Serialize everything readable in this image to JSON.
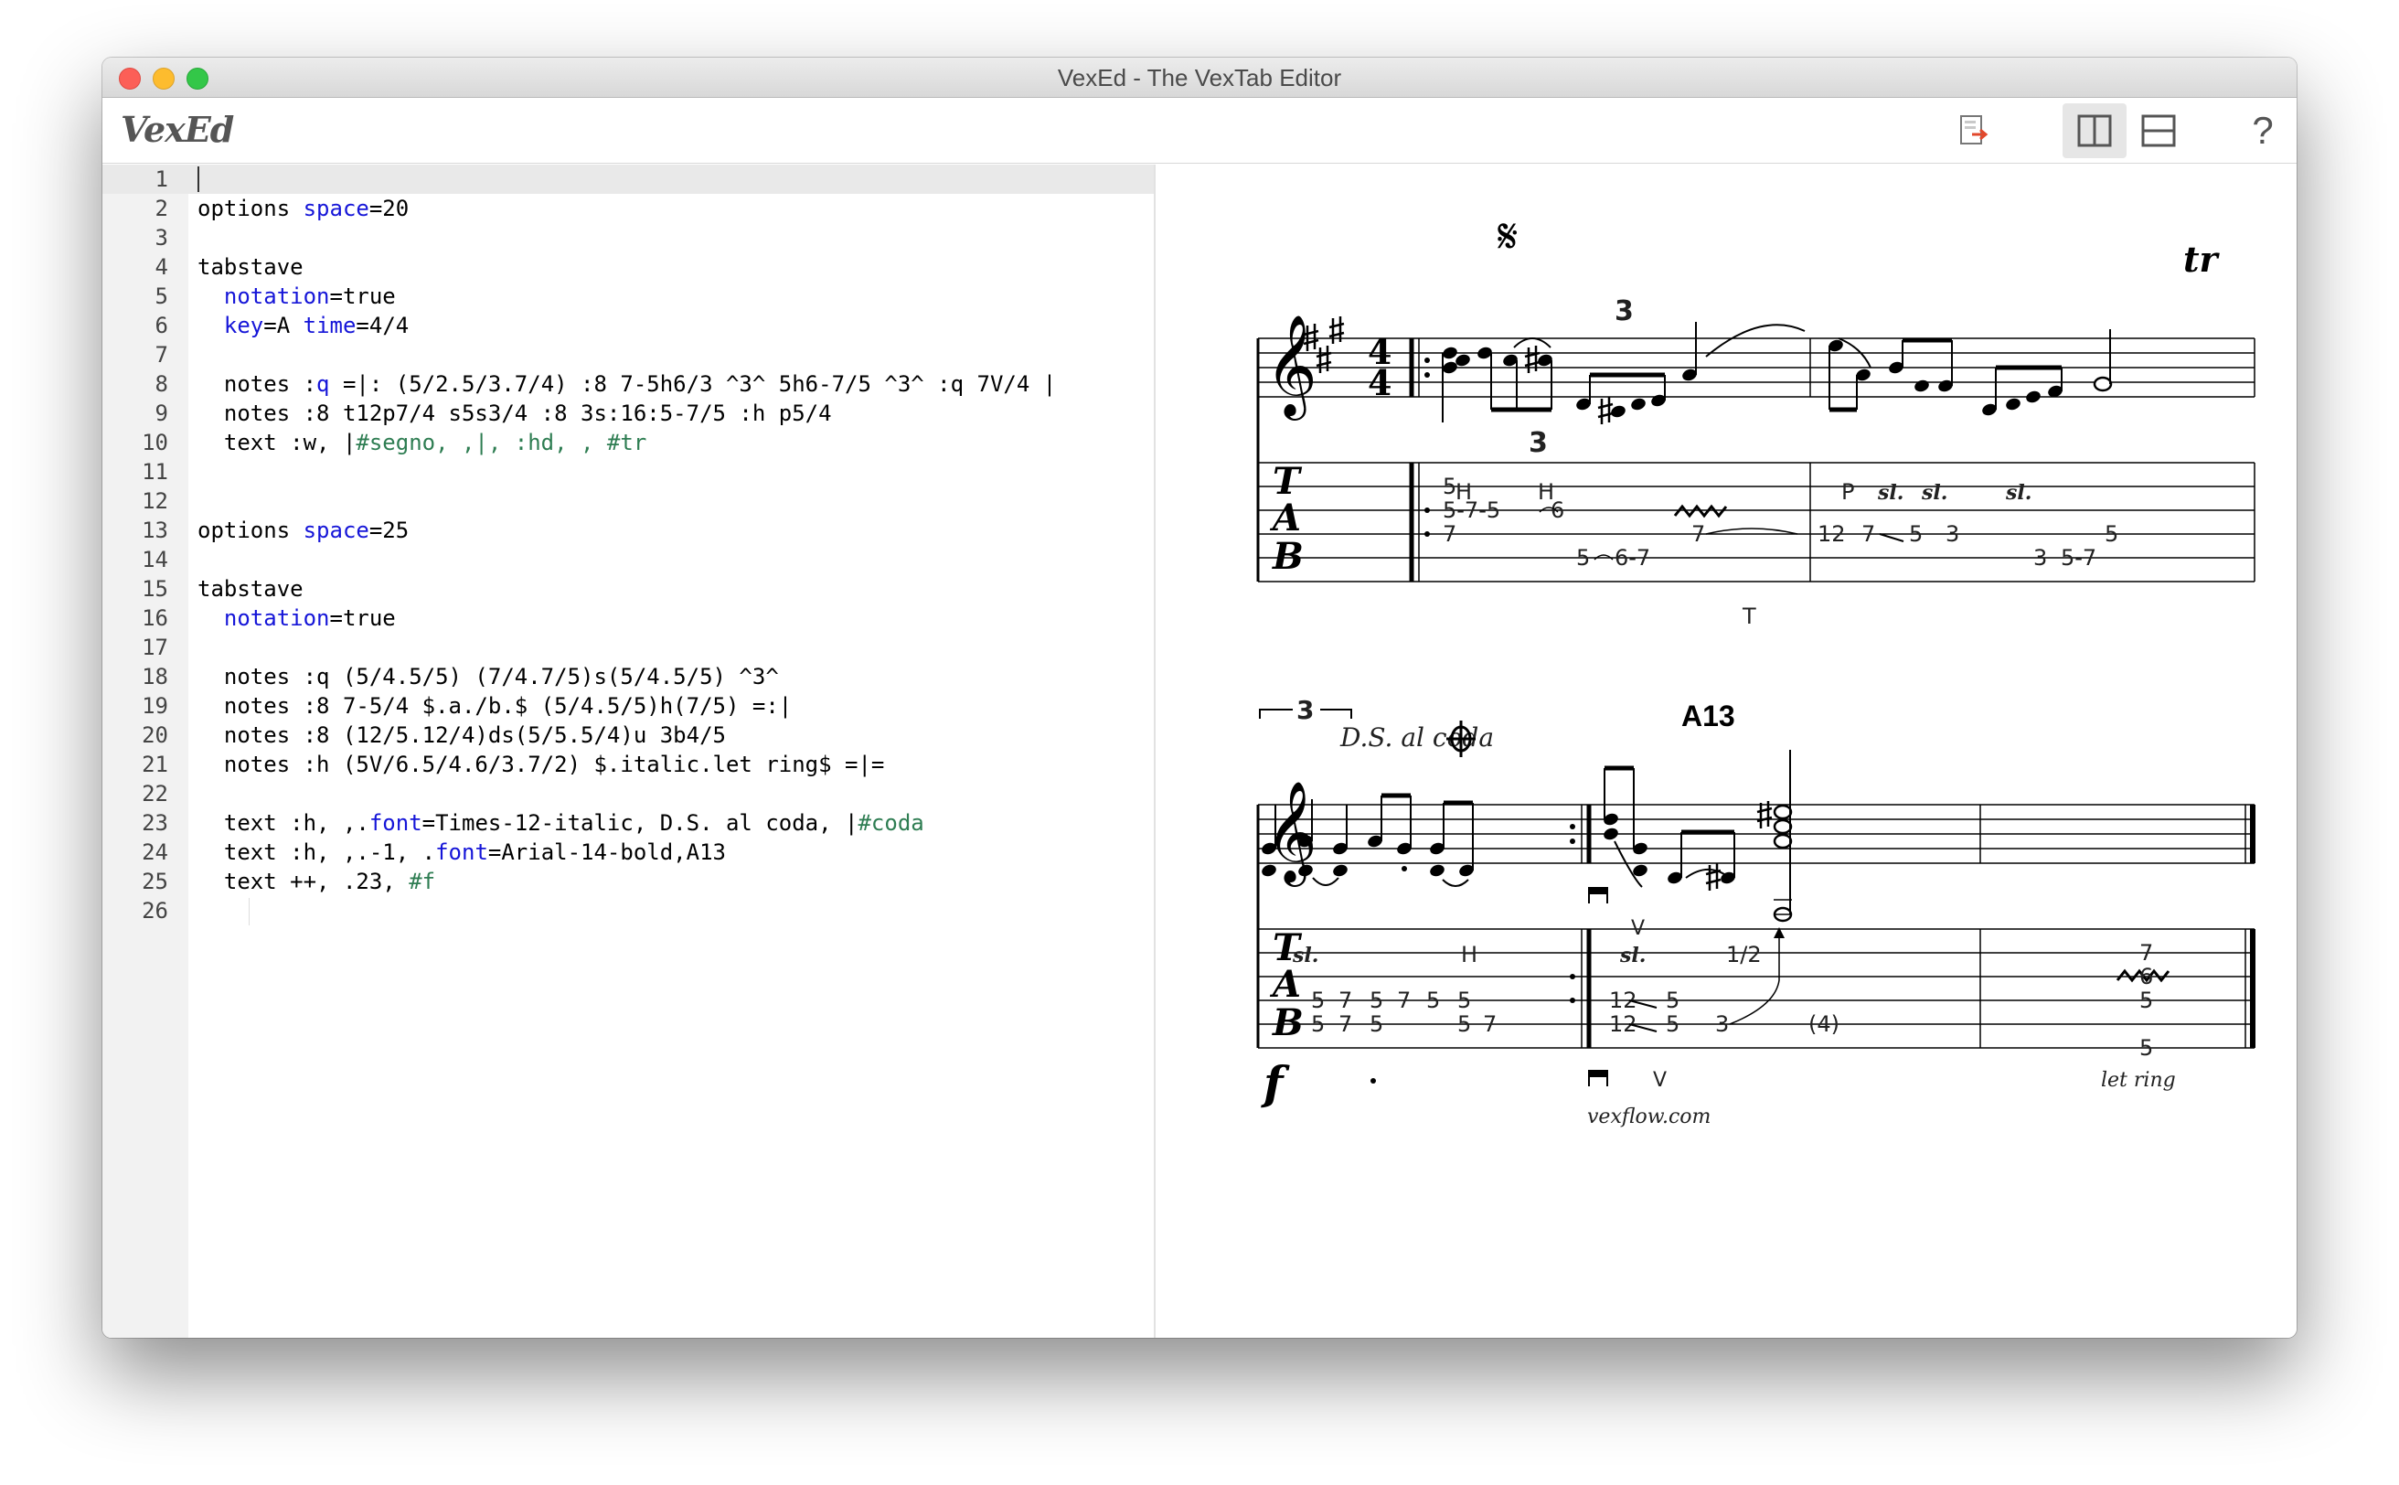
{
  "window": {
    "title": "VexEd - The VexTab Editor"
  },
  "toolbar": {
    "logo": "VexEd",
    "help_label": "?",
    "icons": [
      "export-icon",
      "split-vertical-icon",
      "split-horizontal-icon"
    ]
  },
  "editor": {
    "lines": [
      {
        "n": "1",
        "segs": [
          [
            "",
            ""
          ]
        ]
      },
      {
        "n": "2",
        "segs": [
          [
            "options ",
            ""
          ],
          [
            "space",
            "kw"
          ],
          [
            "=20",
            ""
          ]
        ]
      },
      {
        "n": "3",
        "segs": [
          [
            "",
            ""
          ]
        ]
      },
      {
        "n": "4",
        "segs": [
          [
            "tabstave",
            ""
          ]
        ]
      },
      {
        "n": "5",
        "segs": [
          [
            "  ",
            ""
          ],
          [
            "notation",
            "kw"
          ],
          [
            "=true",
            ""
          ]
        ]
      },
      {
        "n": "6",
        "segs": [
          [
            "  ",
            ""
          ],
          [
            "key",
            "kw"
          ],
          [
            "=A ",
            ""
          ],
          [
            "time",
            "kw"
          ],
          [
            "=4/4",
            ""
          ]
        ]
      },
      {
        "n": "7",
        "segs": [
          [
            "",
            ""
          ]
        ]
      },
      {
        "n": "8",
        "segs": [
          [
            "  notes :",
            ""
          ],
          [
            "q",
            "kw"
          ],
          [
            " =|: (5/2.5/3.7/4) :8 7-5h6/3 ^3^ 5h6-7/5 ^3^ :q 7V/4 |",
            ""
          ]
        ]
      },
      {
        "n": "9",
        "segs": [
          [
            "  notes :8 t12p7/4 s5s3/4 :8 3s:16:5-7/5 :h p5/4",
            ""
          ]
        ]
      },
      {
        "n": "10",
        "segs": [
          [
            "  text :w, |",
            ""
          ],
          [
            "#segno, ,|, :hd, , #tr",
            "gr"
          ]
        ]
      },
      {
        "n": "11",
        "segs": [
          [
            "",
            ""
          ]
        ]
      },
      {
        "n": "12",
        "segs": [
          [
            "",
            ""
          ]
        ]
      },
      {
        "n": "13",
        "segs": [
          [
            "options ",
            ""
          ],
          [
            "space",
            "kw"
          ],
          [
            "=25",
            ""
          ]
        ]
      },
      {
        "n": "14",
        "segs": [
          [
            "",
            ""
          ]
        ]
      },
      {
        "n": "15",
        "segs": [
          [
            "tabstave",
            ""
          ]
        ]
      },
      {
        "n": "16",
        "segs": [
          [
            "  ",
            ""
          ],
          [
            "notation",
            "kw"
          ],
          [
            "=true",
            ""
          ]
        ]
      },
      {
        "n": "17",
        "segs": [
          [
            "",
            ""
          ]
        ]
      },
      {
        "n": "18",
        "segs": [
          [
            "  notes :q (5/4.5/5) (7/4.7/5)s(5/4.5/5) ^3^",
            ""
          ]
        ]
      },
      {
        "n": "19",
        "segs": [
          [
            "  notes :8 7-5/4 $.a./b.$ (5/4.5/5)h(7/5) =:|",
            ""
          ]
        ]
      },
      {
        "n": "20",
        "segs": [
          [
            "  notes :8 (12/5.12/4)ds(5/5.5/4)u 3b4/5",
            ""
          ]
        ]
      },
      {
        "n": "21",
        "segs": [
          [
            "  notes :h (5V/6.5/4.6/3.7/2) $.italic.let ring$ =|=",
            ""
          ]
        ]
      },
      {
        "n": "22",
        "segs": [
          [
            "",
            ""
          ]
        ]
      },
      {
        "n": "23",
        "segs": [
          [
            "  text :h, ,.",
            ""
          ],
          [
            "font",
            "kw"
          ],
          [
            "=Times-12-italic, D.S. al coda, |",
            ""
          ],
          [
            "#coda",
            "gr"
          ]
        ]
      },
      {
        "n": "24",
        "segs": [
          [
            "  text :h, ,.-1, .",
            ""
          ],
          [
            "font",
            "kw"
          ],
          [
            "=Arial-14-bold,A13",
            ""
          ]
        ]
      },
      {
        "n": "25",
        "segs": [
          [
            "  text ++, .23, ",
            ""
          ],
          [
            "#f",
            "gr"
          ]
        ]
      },
      {
        "n": "26",
        "segs": [
          [
            "",
            ""
          ]
        ]
      }
    ]
  },
  "score": {
    "annotations1": [
      "H",
      "H",
      "P",
      "sl.",
      "sl.",
      "sl."
    ],
    "tuplet": "3",
    "tab_letters": [
      "T",
      "A",
      "B"
    ],
    "tab1": {
      "m1": [
        "5",
        "5-7-5",
        "6",
        "7",
        "5",
        "6-7",
        "7"
      ],
      "m2": [
        "12",
        "7",
        "5",
        "3",
        "3",
        "5-7",
        "5"
      ]
    },
    "t_marker": "T",
    "ds_text": "D.S. al coda",
    "chord": "A13",
    "annotations2": [
      "sl.",
      "H",
      "sl.",
      "1/2"
    ],
    "bend_text": "1/2",
    "tab2": {
      "m1": [
        "5",
        "7",
        "5",
        "7",
        "5",
        "5",
        "5",
        "7",
        "5",
        "5",
        "7"
      ],
      "m2": [
        "12",
        "5",
        "12",
        "5",
        "3",
        "(4)"
      ],
      "m3": [
        "7",
        "6",
        "5",
        "5"
      ]
    },
    "below2": [
      "f",
      "V",
      "let ring"
    ],
    "vibrato_mark": "V",
    "footer": "vexflow.com"
  }
}
